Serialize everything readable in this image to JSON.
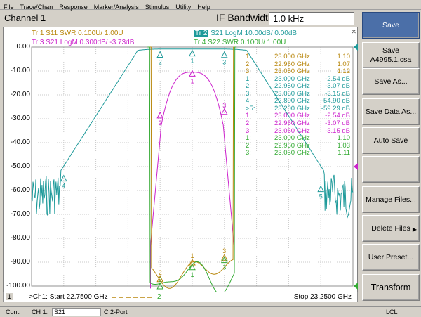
{
  "menu": [
    "File",
    "Trace/Chan",
    "Response",
    "Marker/Analysis",
    "Stimulus",
    "Utility",
    "Help"
  ],
  "header": {
    "channel_title": "Channel 1",
    "ifbw_label": "IF Bandwidth",
    "ifbw_value": "1.0 kHz"
  },
  "traces": {
    "t1": {
      "label": "Tr  1   S11 SWR 0.100U/  1.00U",
      "color": "#b8860b"
    },
    "t2": {
      "label": "Tr  2",
      "rest": "S21 LogM 10.00dB/  0.00dB",
      "color": "#1e9a9a"
    },
    "t3": {
      "label": "Tr  3   S21 LogM 0.300dB/  -3.73dB",
      "color": "#cc22cc"
    },
    "t4": {
      "label": "Tr  4   S22 SWR 0.100U/  1.00U",
      "color": "#33aa33"
    }
  },
  "y_ticks": [
    "0.00",
    "-10.00",
    "-20.00",
    "-30.00",
    "-40.00",
    "-50.00",
    "-60.00",
    "-70.00",
    "-80.00",
    "-90.00",
    "-100.00"
  ],
  "marker_table": [
    {
      "idx": "1:",
      "freq": "23.000 GHz",
      "val": "1.10",
      "color": "#b8860b"
    },
    {
      "idx": "2:",
      "freq": "22.950 GHz",
      "val": "1.07",
      "color": "#b8860b"
    },
    {
      "idx": "3:",
      "freq": "23.050 GHz",
      "val": "1.12",
      "color": "#b8860b"
    },
    {
      "idx": "1:",
      "freq": "23.000 GHz",
      "val": "-2.54 dB",
      "color": "#1e9a9a"
    },
    {
      "idx": "2:",
      "freq": "22.950 GHz",
      "val": "-3.07 dB",
      "color": "#1e9a9a"
    },
    {
      "idx": "3:",
      "freq": "23.050 GHz",
      "val": "-3.15 dB",
      "color": "#1e9a9a"
    },
    {
      "idx": "4:",
      "freq": "22.800 GHz",
      "val": "-54.90 dB",
      "color": "#1e9a9a"
    },
    {
      "idx": ">5:",
      "freq": "23.200 GHz",
      "val": "-59.29 dB",
      "color": "#1e9a9a"
    },
    {
      "idx": "1:",
      "freq": "23.000 GHz",
      "val": "-2.54 dB",
      "color": "#cc22cc"
    },
    {
      "idx": "2:",
      "freq": "22.950 GHz",
      "val": "-3.07 dB",
      "color": "#cc22cc"
    },
    {
      "idx": "3:",
      "freq": "23.050 GHz",
      "val": "-3.15 dB",
      "color": "#cc22cc"
    },
    {
      "idx": "1:",
      "freq": "23.000 GHz",
      "val": "1.10",
      "color": "#33aa33"
    },
    {
      "idx": "2:",
      "freq": "22.950 GHz",
      "val": "1.03",
      "color": "#33aa33"
    },
    {
      "idx": "3:",
      "freq": "23.050 GHz",
      "val": "1.11",
      "color": "#33aa33"
    }
  ],
  "status": {
    "channel_num": "1",
    "start": ">Ch1: Start  22.7500 GHz",
    "stop": "Stop  23.2500 GHz",
    "marker_label": "2"
  },
  "softkeys": [
    {
      "label": "Save",
      "active": true
    },
    {
      "label": "Save\nA4995.1.csa",
      "active": false
    },
    {
      "label": "Save As...",
      "active": false
    },
    {
      "label": "Save Data As...",
      "active": false
    },
    {
      "label": "Auto Save",
      "active": false
    },
    {
      "label": "",
      "active": false
    },
    {
      "label": "Manage Files...",
      "active": false
    },
    {
      "label": "Delete Files",
      "active": false,
      "arrow": true
    },
    {
      "label": "User Preset...",
      "active": false
    },
    {
      "label": "Transform",
      "active": false,
      "big": true
    }
  ],
  "bottombar": {
    "mode": "Cont.",
    "channel": "CH 1:",
    "param": "S21",
    "port": "C  2-Port",
    "remote": "LCL"
  },
  "chart_data": {
    "type": "line",
    "x_unit": "GHz",
    "xlim": [
      22.75,
      23.25
    ],
    "ylim": [
      -100,
      0
    ],
    "grid": true,
    "series": [
      {
        "name": "Tr 1 S11 SWR",
        "color": "#b8860b"
      },
      {
        "name": "Tr 2 S21 LogM",
        "color": "#1e9a9a"
      },
      {
        "name": "Tr 3 S21 LogM",
        "color": "#cc22cc"
      },
      {
        "name": "Tr 4 S22 SWR",
        "color": "#33aa33"
      }
    ]
  }
}
